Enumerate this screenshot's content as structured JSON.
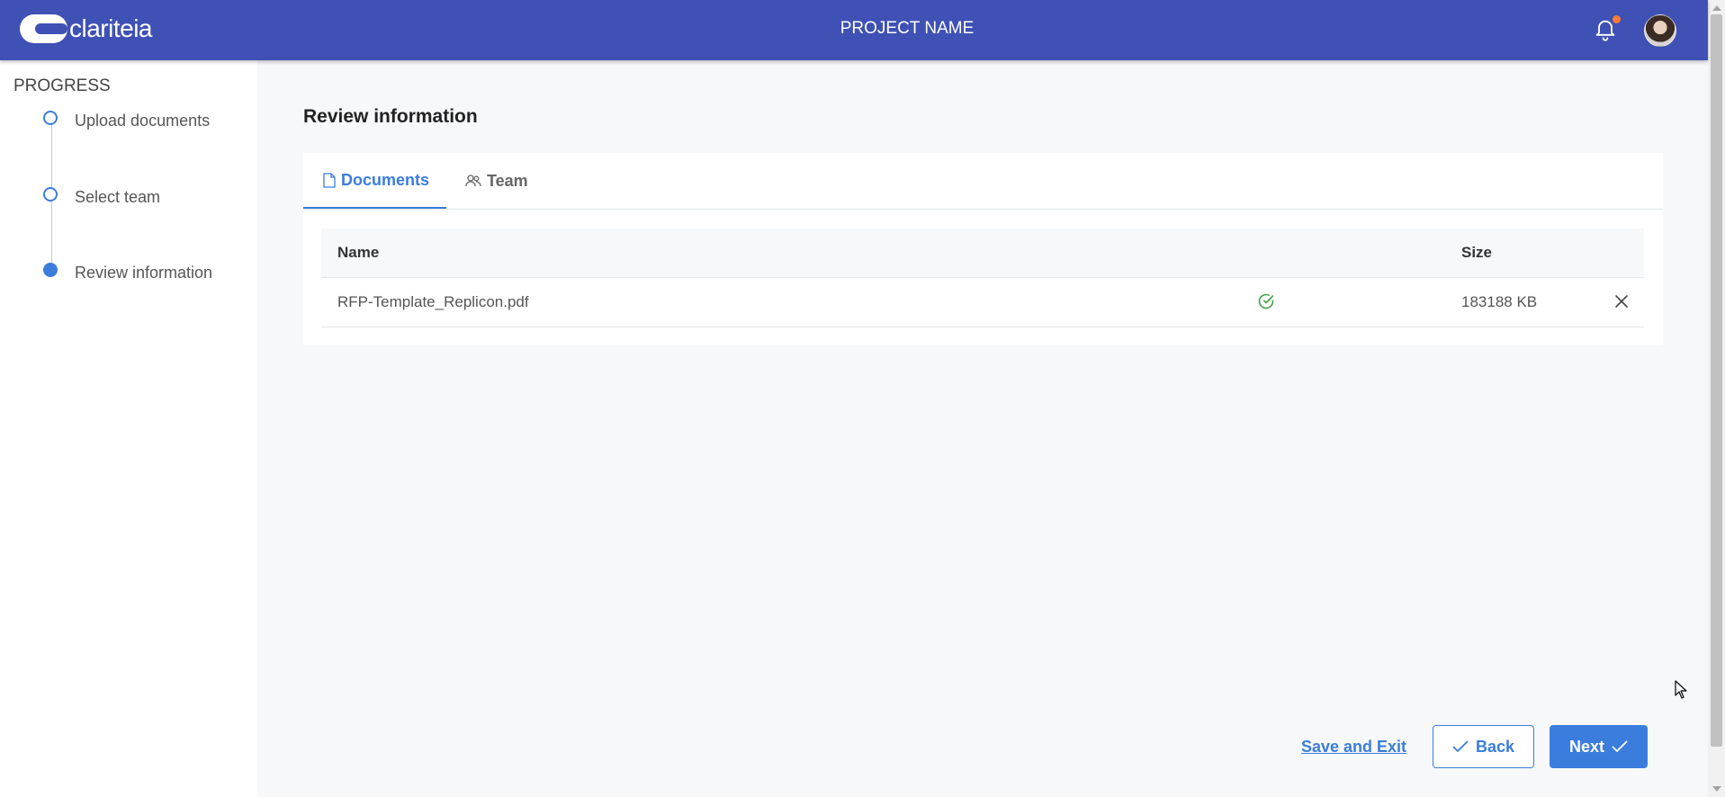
{
  "header": {
    "logo_text": "clariteia",
    "project_name": "PROJECT NAME",
    "notification_icon": "bell-icon",
    "has_unread_notifications": true
  },
  "sidebar": {
    "title": "PROGRESS",
    "steps": [
      {
        "label": "Upload documents",
        "state": "complete"
      },
      {
        "label": "Select team",
        "state": "complete"
      },
      {
        "label": "Review information",
        "state": "current"
      }
    ]
  },
  "main": {
    "title": "Review information",
    "tabs": [
      {
        "label": "Documents",
        "icon": "file-icon",
        "active": true
      },
      {
        "label": "Team",
        "icon": "team-icon",
        "active": false
      }
    ],
    "table": {
      "columns": {
        "name": "Name",
        "size": "Size"
      },
      "rows": [
        {
          "name": "RFP-Template_Replicon.pdf",
          "status": "uploaded",
          "size": "183188 KB"
        }
      ]
    }
  },
  "footer": {
    "save_exit_label": "Save and Exit",
    "back_label": "Back",
    "next_label": "Next"
  },
  "colors": {
    "header_bg": "#3f51b5",
    "accent": "#3b7ddd",
    "success": "#43a047",
    "notification_dot": "#ff7a33"
  }
}
